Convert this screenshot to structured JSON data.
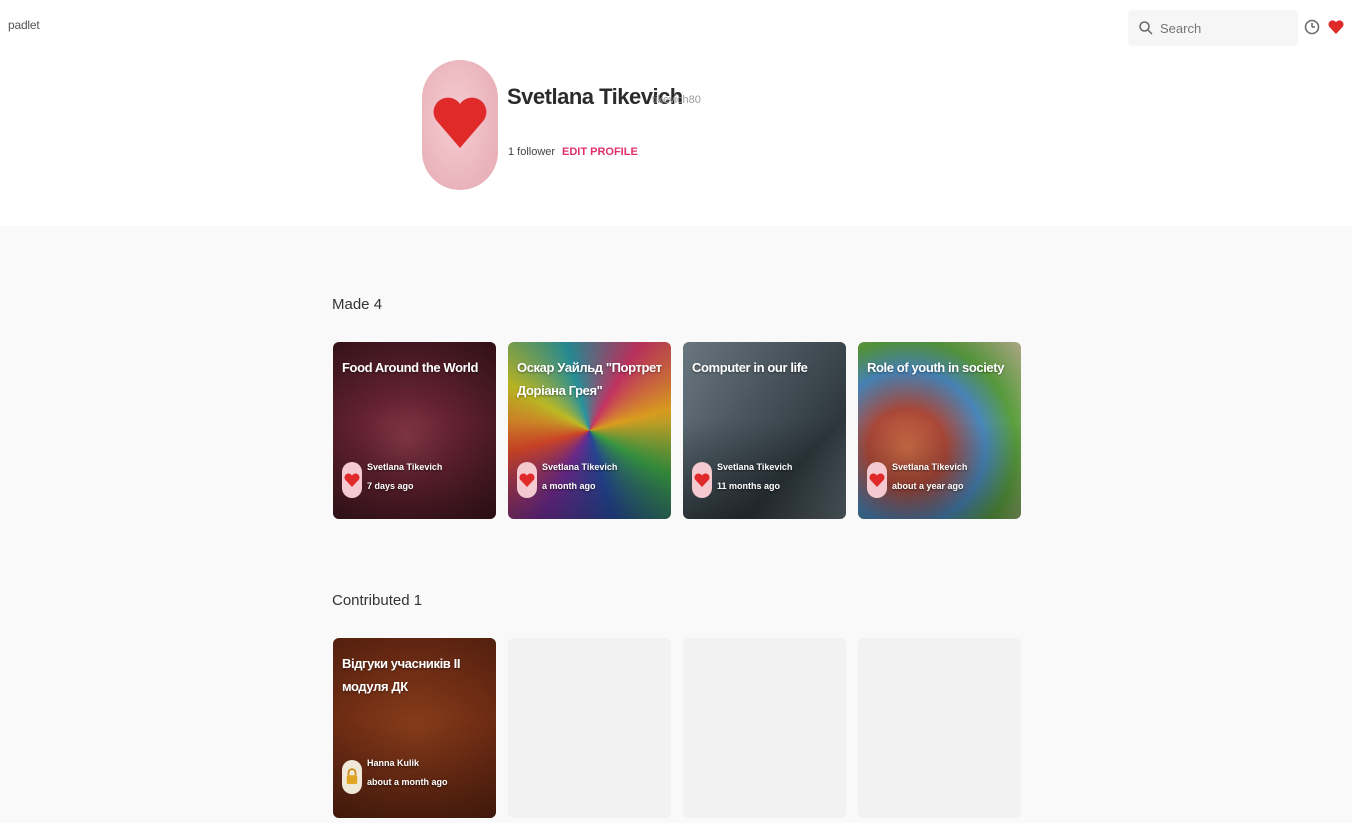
{
  "header": {
    "logo": "padlet",
    "search_placeholder": "Search"
  },
  "profile": {
    "name": "Svetlana Tikevich",
    "handle": "tikevich80",
    "followers": "1 follower",
    "edit_label": "EDIT PROFILE"
  },
  "sections": {
    "made_title": "Made 4",
    "contributed_title": "Contributed 1"
  },
  "made": [
    {
      "title": "Food Around the World",
      "owner": "Svetlana Tikevich",
      "time": "7 days ago"
    },
    {
      "title": "Оскар Уайльд \"Портрет Доріана Грея\"",
      "owner": "Svetlana Tikevich",
      "time": "a month ago"
    },
    {
      "title": "Computer in our life",
      "owner": "Svetlana Tikevich",
      "time": "11 months ago"
    },
    {
      "title": "Role of youth in society",
      "owner": "Svetlana Tikevich",
      "time": "about a year ago"
    }
  ],
  "contributed": [
    {
      "title": "Відгуки учасників II модуля ДК",
      "owner": "Hanna Kulik",
      "time": "about a month ago"
    }
  ],
  "colors": {
    "accent": "#e0306b",
    "heart": "#e02a2a",
    "background": "#f9f9f9"
  }
}
